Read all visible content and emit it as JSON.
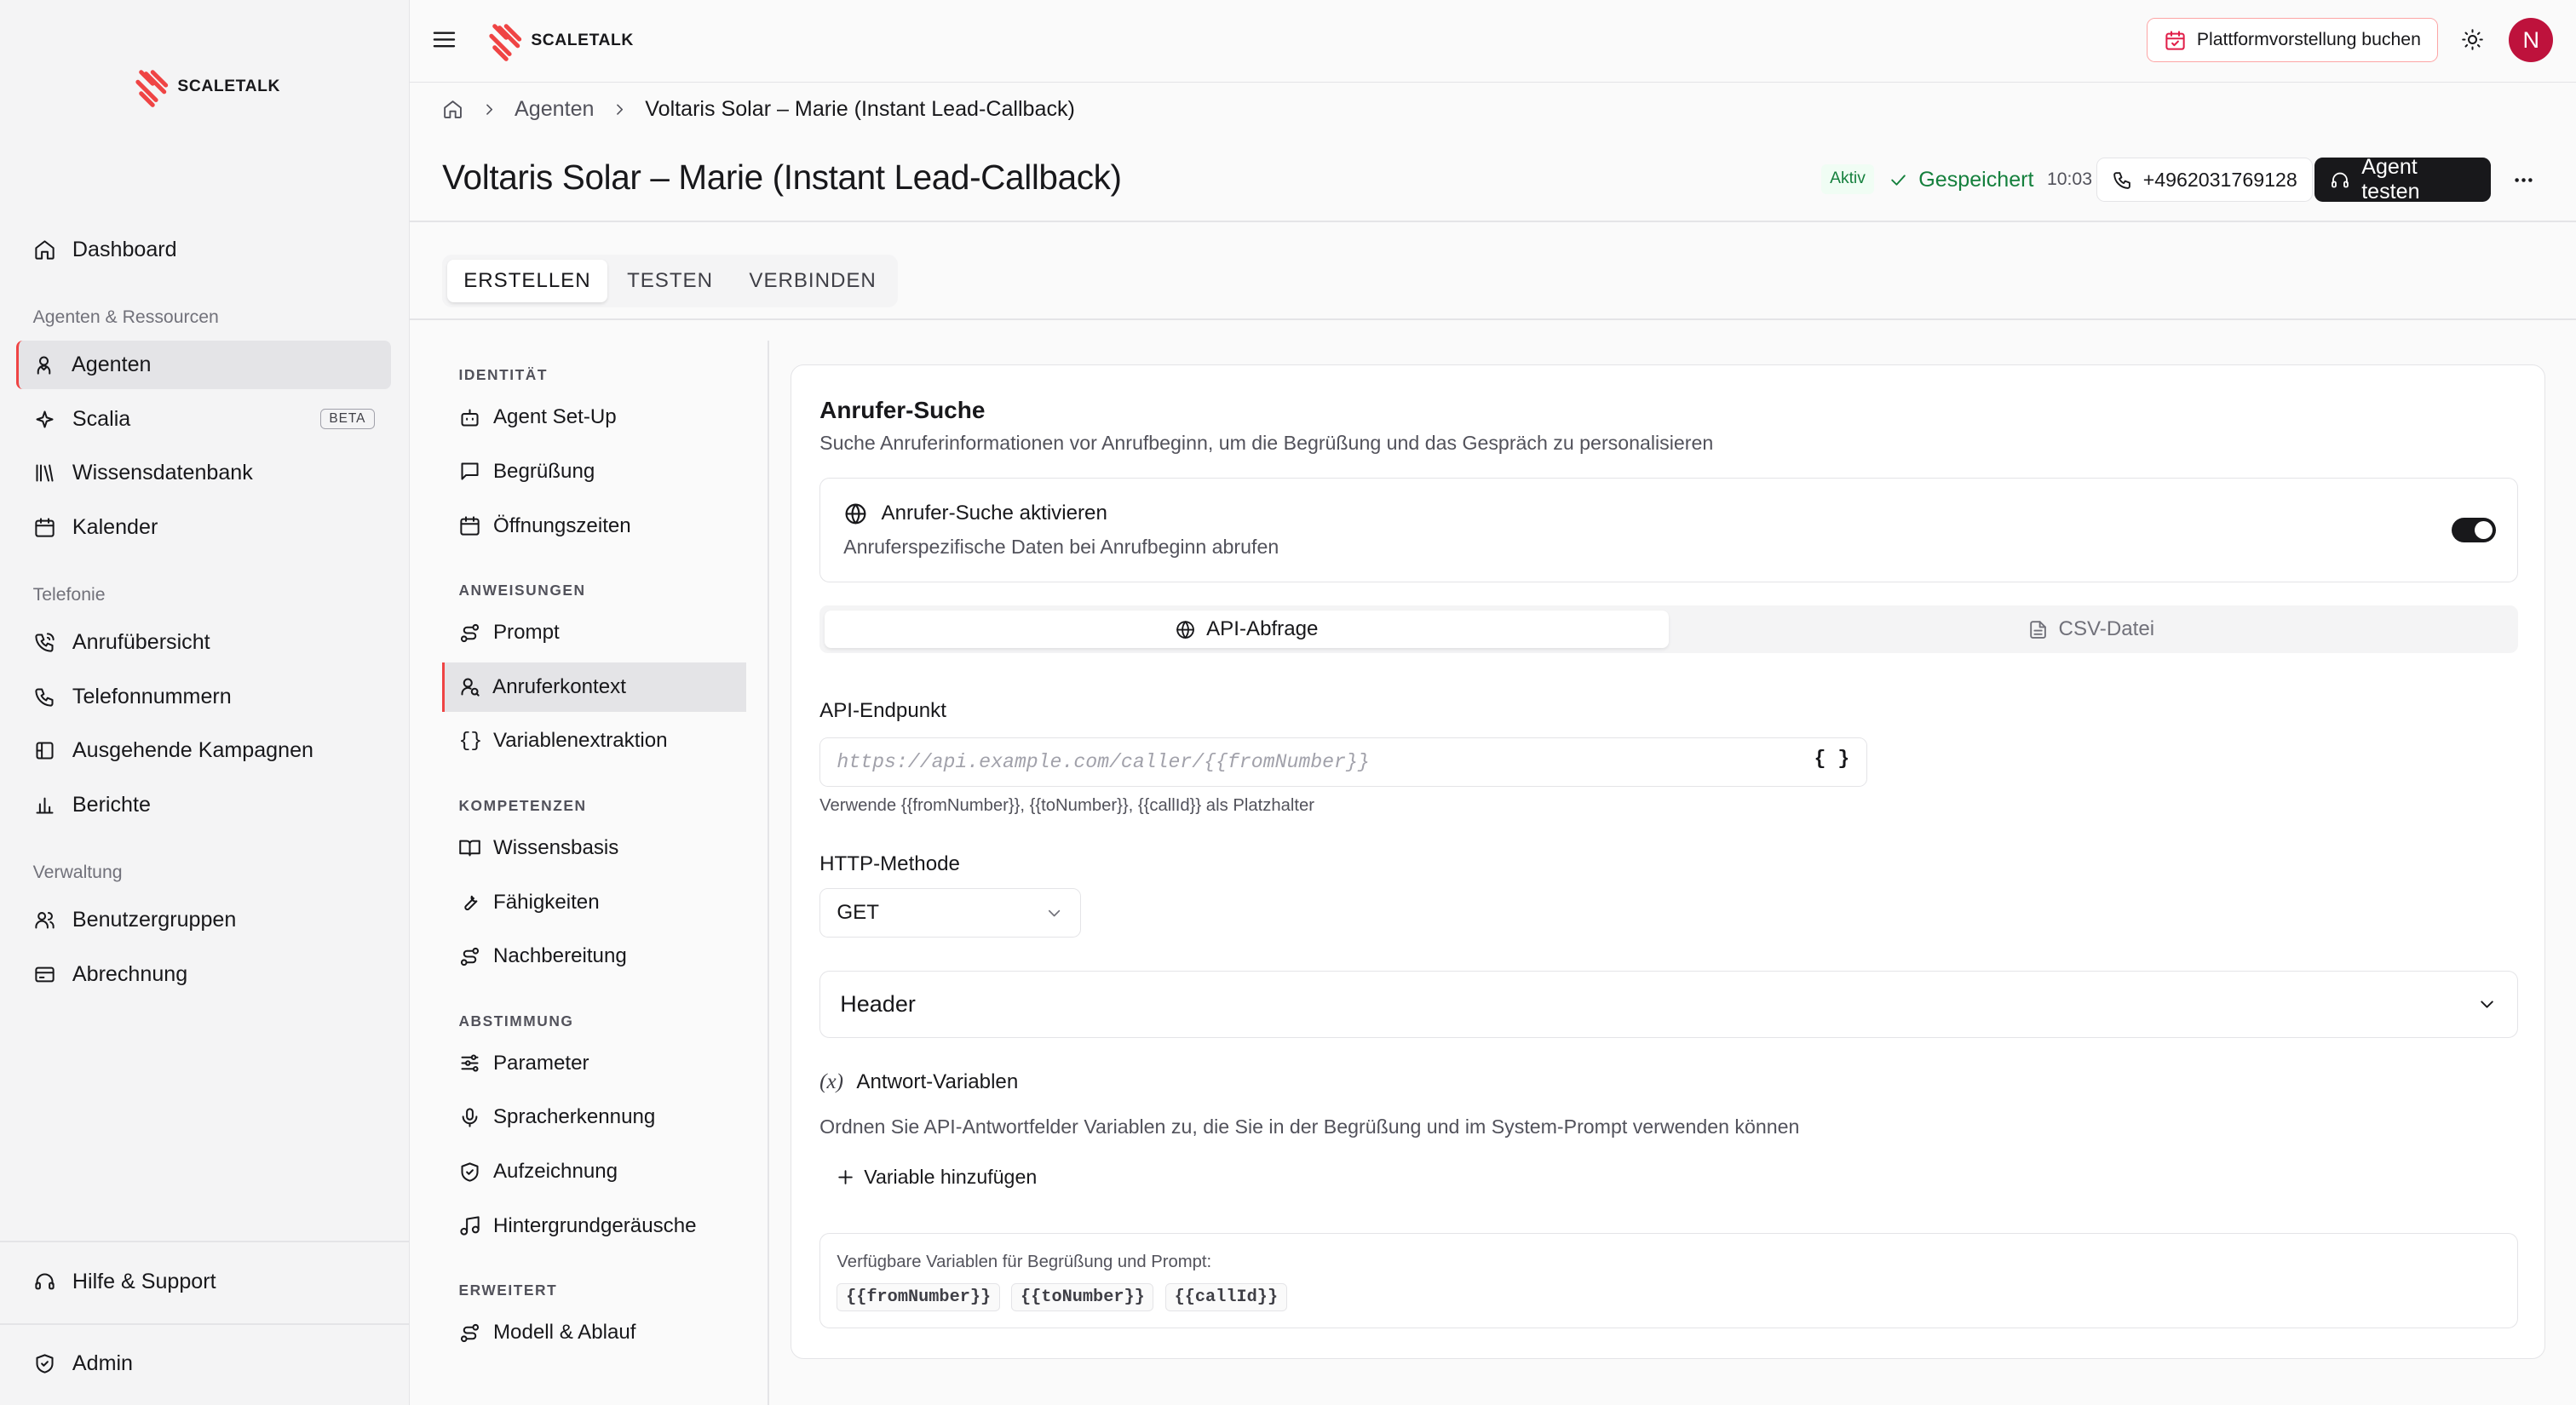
{
  "brand": {
    "name": "SCALETALK",
    "accent": "#ef4444"
  },
  "sidebar": {
    "dashboard": "Dashboard",
    "group_resources": "Agenten & Ressourcen",
    "agents": "Agenten",
    "scalia": "Scalia",
    "beta": "BETA",
    "knowledge_db": "Wissensdatenbank",
    "calendar": "Kalender",
    "group_telephony": "Telefonie",
    "call_overview": "Anrufübersicht",
    "phone_numbers": "Telefonnummern",
    "outbound_campaigns": "Ausgehende Kampagnen",
    "reports": "Berichte",
    "group_admin": "Verwaltung",
    "user_groups": "Benutzergruppen",
    "billing": "Abrechnung",
    "help": "Hilfe & Support",
    "admin": "Admin"
  },
  "topbar": {
    "book_demo": "Plattformvorstellung buchen",
    "avatar_initial": "N"
  },
  "breadcrumb": {
    "parent": "Agenten",
    "current": "Voltaris Solar – Marie (Instant Lead-Callback)"
  },
  "page": {
    "title": "Voltaris Solar – Marie (Instant Lead-Callback)",
    "status_badge": "Aktiv",
    "saved_label": "Gespeichert",
    "saved_time": "10:03",
    "phone_number": "+4962031769128",
    "test_agent": "Agent testen"
  },
  "tabs": [
    "ERSTELLEN",
    "TESTEN",
    "VERBINDEN"
  ],
  "subnav": {
    "identity": "IDENTITÄT",
    "agent_setup": "Agent Set-Up",
    "greeting": "Begrüßung",
    "hours": "Öffnungszeiten",
    "instructions": "ANWEISUNGEN",
    "prompt": "Prompt",
    "caller_context": "Anruferkontext",
    "var_extraction": "Variablenextraktion",
    "skills_group": "KOMPETENZEN",
    "knowledge_base": "Wissensbasis",
    "abilities": "Fähigkeiten",
    "post_processing": "Nachbereitung",
    "tuning": "ABSTIMMUNG",
    "parameters": "Parameter",
    "speech_recognition": "Spracherkennung",
    "recording": "Aufzeichnung",
    "background_noise": "Hintergrundgeräusche",
    "advanced": "ERWEITERT",
    "model_flow": "Modell & Ablauf"
  },
  "card": {
    "title": "Anrufer-Suche",
    "description": "Suche Anruferinformationen vor Anrufbeginn, um die Begrüßung und das Gespräch zu personalisieren",
    "toggle_title": "Anrufer-Suche aktivieren",
    "toggle_desc": "Anruferspezifische Daten bei Anrufbeginn abrufen",
    "toggle_on": true,
    "seg_api": "API-Abfrage",
    "seg_csv": "CSV-Datei",
    "endpoint_label": "API-Endpunkt",
    "endpoint_placeholder": "https://api.example.com/caller/{{fromNumber}}",
    "endpoint_hint": "Verwende {{fromNumber}}, {{toNumber}}, {{callId}} als Platzhalter",
    "method_label": "HTTP-Methode",
    "method_value": "GET",
    "header_label": "Header",
    "resp_vars_title": "Antwort-Variablen",
    "resp_vars_desc": "Ordnen Sie API-Antwortfelder Variablen zu, die Sie in der Begrüßung und im System-Prompt verwenden können",
    "add_variable": "Variable hinzufügen",
    "available_vars_label": "Verfügbare Variablen für Begrüßung und Prompt:",
    "chips": [
      "{{fromNumber}}",
      "{{toNumber}}",
      "{{callId}}"
    ]
  }
}
